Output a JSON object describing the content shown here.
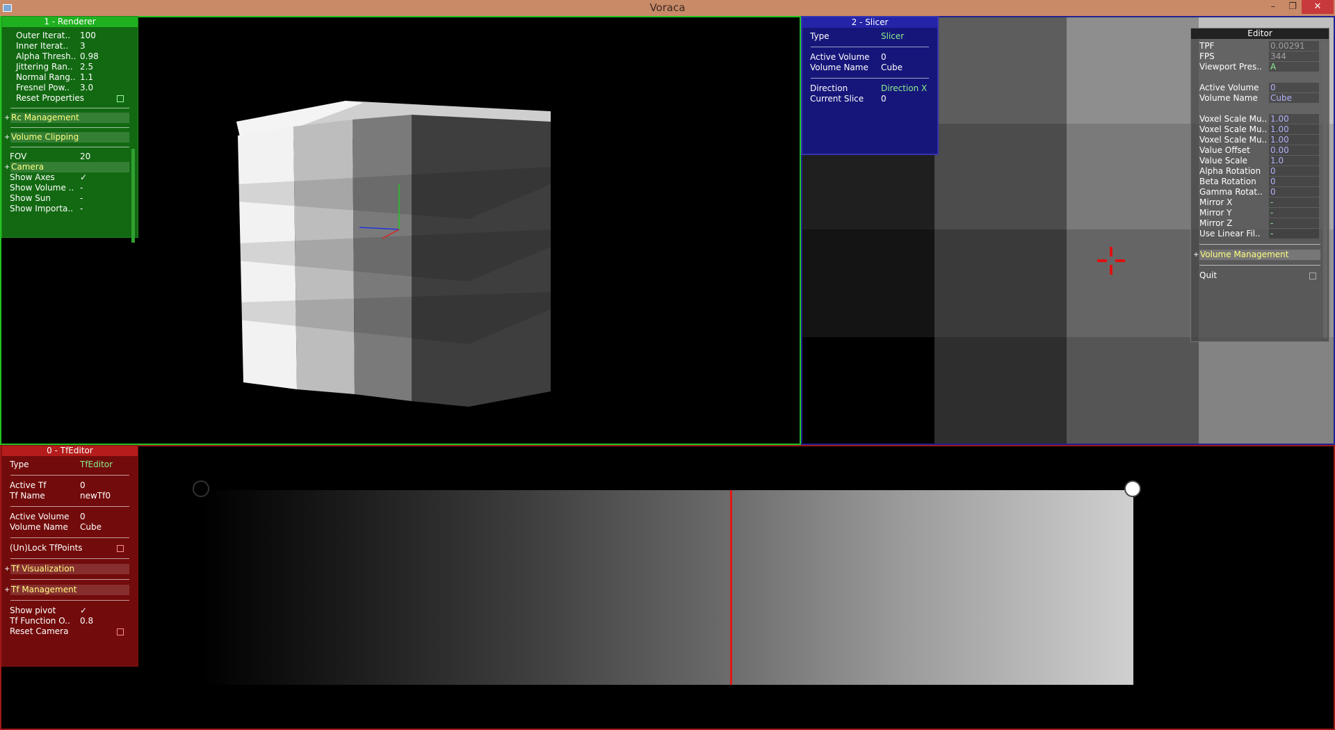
{
  "window": {
    "title": "Voraca",
    "minimize": "–",
    "restore": "❐",
    "close": "✕"
  },
  "renderer": {
    "title": "1 - Renderer",
    "props": [
      {
        "label": "Outer Iterat..",
        "value": "100"
      },
      {
        "label": "Inner Iterat..",
        "value": "3"
      },
      {
        "label": "Alpha Thresh..",
        "value": "0.98"
      },
      {
        "label": "Jittering Ran..",
        "value": "2.5"
      },
      {
        "label": "Normal Rang..",
        "value": "1.1"
      },
      {
        "label": "Fresnel Pow..",
        "value": "3.0"
      }
    ],
    "reset_label": "Reset Properties",
    "rc_management": "Rc Management",
    "volume_clipping": "Volume Clipping",
    "fov_label": "FOV",
    "fov_value": "20",
    "camera": "Camera",
    "show_axes": "Show Axes",
    "show_axes_value": "✓",
    "show_volume": "Show Volume ..",
    "show_volume_value": "-",
    "show_sun": "Show Sun",
    "show_sun_value": "-",
    "show_importance": "Show Importa..",
    "show_importance_value": "-"
  },
  "slicer": {
    "title": "2 - Slicer",
    "type_label": "Type",
    "type_value": "Slicer",
    "active_volume_label": "Active Volume",
    "active_volume_value": "0",
    "volume_name_label": "Volume Name",
    "volume_name_value": "Cube",
    "direction_label": "Direction",
    "direction_value": "Direction X",
    "current_slice_label": "Current Slice",
    "current_slice_value": "0"
  },
  "editor": {
    "title": "Editor",
    "rows_a": [
      {
        "label": "TPF",
        "value": "0.00291",
        "style": "grey"
      },
      {
        "label": "FPS",
        "value": "344",
        "style": "grey"
      },
      {
        "label": "Viewport Pres..",
        "value": "A",
        "style": "green"
      }
    ],
    "rows_b": [
      {
        "label": "Active Volume",
        "value": "0"
      },
      {
        "label": "Volume Name",
        "value": "Cube"
      }
    ],
    "rows_c": [
      {
        "label": "Voxel Scale Mu..",
        "value": "1.00"
      },
      {
        "label": "Voxel Scale Mu..",
        "value": "1.00"
      },
      {
        "label": "Voxel Scale Mu..",
        "value": "1.00"
      },
      {
        "label": "Value Offset",
        "value": "0.00"
      },
      {
        "label": "Value Scale",
        "value": "1.0"
      },
      {
        "label": "Alpha Rotation",
        "value": "0"
      },
      {
        "label": "Beta Rotation",
        "value": "0"
      },
      {
        "label": "Gamma Rotat..",
        "value": "0"
      },
      {
        "label": "Mirror X",
        "value": "-"
      },
      {
        "label": "Mirror Y",
        "value": "-"
      },
      {
        "label": "Mirror Z",
        "value": "-"
      },
      {
        "label": "Use Linear Fil..",
        "value": "-"
      }
    ],
    "volume_management": "Volume Management",
    "quit": "Quit"
  },
  "tfeditor": {
    "title": "0 - TfEditor",
    "type_label": "Type",
    "type_value": "TfEditor",
    "active_tf_label": "Active Tf",
    "active_tf_value": "0",
    "tf_name_label": "Tf Name",
    "tf_name_value": "newTf0",
    "active_volume_label": "Active Volume",
    "active_volume_value": "0",
    "volume_name_label": "Volume Name",
    "volume_name_value": "Cube",
    "unlock_label": "(Un)Lock TfPoints",
    "tf_visualization": "Tf Visualization",
    "tf_management": "Tf Management",
    "show_pivot_label": "Show pivot",
    "show_pivot_value": "✓",
    "tf_function_label": "Tf Function O..",
    "tf_function_value": "0.8",
    "reset_camera_label": "Reset Camera"
  },
  "icons": [
    "app-icon",
    "axis-gizmo",
    "crosshair-icon",
    "check-icon",
    "plus-icon"
  ],
  "colors": {
    "renderer_border": "#22c422",
    "slicer_border": "#202090",
    "tf_border": "#a01818",
    "pivot": "#e01818"
  }
}
